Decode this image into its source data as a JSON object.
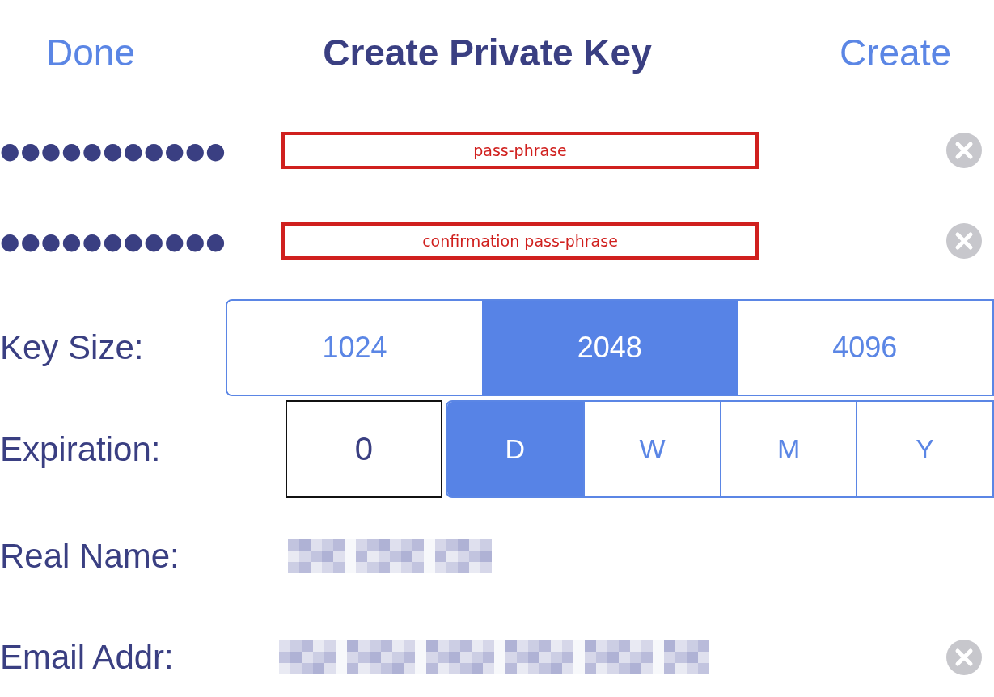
{
  "nav": {
    "left_button": "Done",
    "title": "Create Private Key",
    "right_button": "Create"
  },
  "passphrase_fields": [
    {
      "value": "●●●●●●●●●●●",
      "annotation": "pass-phrase"
    },
    {
      "value": "●●●●●●●●●●●",
      "annotation": "confirmation pass-phrase"
    }
  ],
  "key_size": {
    "label": "Key Size:",
    "options": [
      {
        "label": "1024",
        "selected": false
      },
      {
        "label": "2048",
        "selected": true
      },
      {
        "label": "4096",
        "selected": false
      }
    ]
  },
  "expiration": {
    "label": "Expiration:",
    "value": "0",
    "units": [
      {
        "label": "D",
        "selected": true
      },
      {
        "label": "W",
        "selected": false
      },
      {
        "label": "M",
        "selected": false
      },
      {
        "label": "Y",
        "selected": false
      }
    ]
  },
  "real_name": {
    "label": "Real Name:"
  },
  "email": {
    "label": "Email Addr:"
  }
}
